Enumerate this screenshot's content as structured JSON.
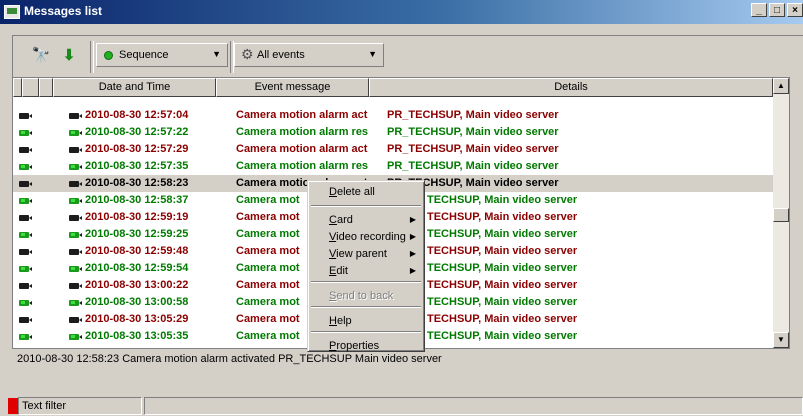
{
  "window": {
    "title": "Messages list",
    "controls": {
      "minimize": "_",
      "maximize": "□",
      "close": "×"
    }
  },
  "toolbar": {
    "find_icon": "binoculars-icon",
    "download_icon": "down-arrow-icon",
    "mode_select": "Sequence",
    "events_select": "All events"
  },
  "table": {
    "columns": [
      "",
      "",
      "",
      "Date and Time",
      "Event message",
      "Details"
    ],
    "rows": [
      {
        "date": "2010-08-30 12:57:04",
        "message": "Camera motion alarm act",
        "details": "PR_TECHSUP, Main video server",
        "color": "#8b0000",
        "status": "red"
      },
      {
        "date": "2010-08-30 12:57:22",
        "message": "Camera motion alarm res",
        "details": "PR_TECHSUP, Main video server",
        "color": "#007a00",
        "status": "green"
      },
      {
        "date": "2010-08-30 12:57:29",
        "message": "Camera motion alarm act",
        "details": "PR_TECHSUP, Main video server",
        "color": "#8b0000",
        "status": "red"
      },
      {
        "date": "2010-08-30 12:57:35",
        "message": "Camera motion alarm res",
        "details": "PR_TECHSUP, Main video server",
        "color": "#007a00",
        "status": "green"
      },
      {
        "date": "2010-08-30 12:58:23",
        "message": "Camera motion alarm act",
        "details": "PR_TECHSUP, Main video server",
        "color": "#000000",
        "status": "red",
        "selected": true
      },
      {
        "date": "2010-08-30 12:58:37",
        "message": "Camera mot",
        "details": "TECHSUP, Main video server",
        "color": "#007a00",
        "status": "green"
      },
      {
        "date": "2010-08-30 12:59:19",
        "message": "Camera mot",
        "details": "TECHSUP, Main video server",
        "color": "#8b0000",
        "status": "red"
      },
      {
        "date": "2010-08-30 12:59:25",
        "message": "Camera mot",
        "details": "TECHSUP, Main video server",
        "color": "#007a00",
        "status": "green"
      },
      {
        "date": "2010-08-30 12:59:48",
        "message": "Camera mot",
        "details": "TECHSUP, Main video server",
        "color": "#8b0000",
        "status": "red"
      },
      {
        "date": "2010-08-30 12:59:54",
        "message": "Camera mot",
        "details": "TECHSUP, Main video server",
        "color": "#007a00",
        "status": "green"
      },
      {
        "date": "2010-08-30 13:00:22",
        "message": "Camera mot",
        "details": "TECHSUP, Main video server",
        "color": "#8b0000",
        "status": "red"
      },
      {
        "date": "2010-08-30 13:00:58",
        "message": "Camera mot",
        "details": "TECHSUP, Main video server",
        "color": "#007a00",
        "status": "green"
      },
      {
        "date": "2010-08-30 13:05:29",
        "message": "Camera mot",
        "details": "TECHSUP, Main video server",
        "color": "#8b0000",
        "status": "red"
      },
      {
        "date": "2010-08-30 13:05:35",
        "message": "Camera mot",
        "details": "TECHSUP, Main video server",
        "color": "#007a00",
        "status": "green"
      }
    ]
  },
  "context_menu": {
    "items": [
      {
        "label": "Delete all"
      },
      {
        "label": "Card",
        "submenu": true
      },
      {
        "label": "Video recording",
        "submenu": true
      },
      {
        "label": "View parent",
        "submenu": true
      },
      {
        "label": "Edit",
        "submenu": true
      },
      {
        "label": "Send to back",
        "disabled": true
      },
      {
        "label": "Help"
      },
      {
        "label": "Properties"
      }
    ]
  },
  "status_line": "2010-08-30 12:58:23  Camera motion alarm activated  PR_TECHSUP  Main video server",
  "bottom": {
    "text_filter": "Text filter"
  },
  "colors": {
    "event_red": "#8b0000",
    "event_green": "#007a00",
    "titlebar": "#0a246a",
    "filter_indicator": "#e00000"
  }
}
